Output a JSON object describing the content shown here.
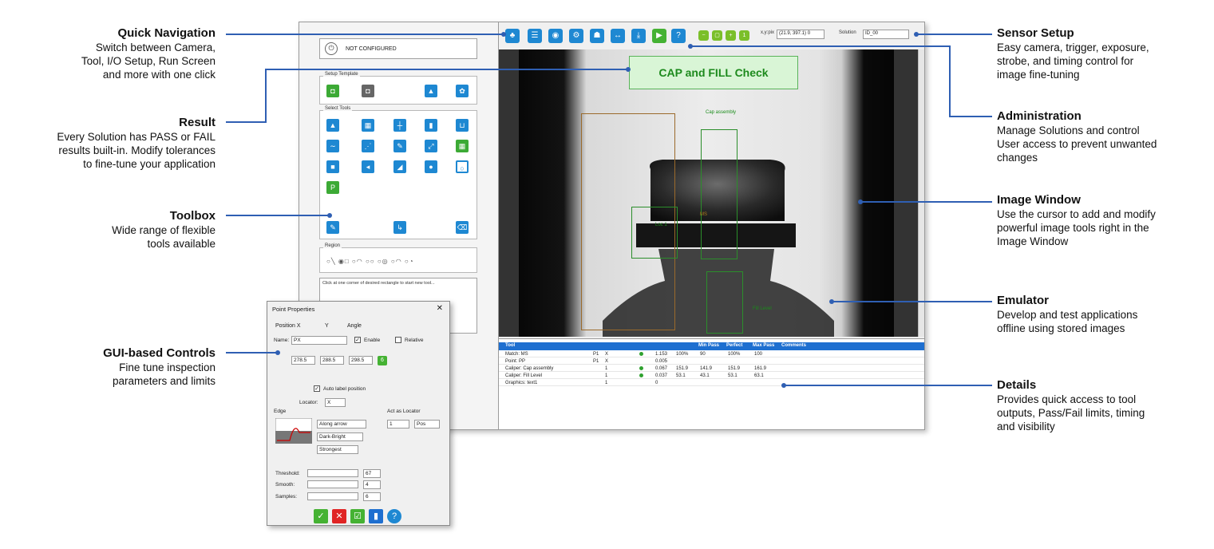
{
  "annotations": {
    "quick_navigation": {
      "title": "Quick Navigation",
      "lines": [
        "Switch between Camera,",
        "Tool, I/O Setup, Run Screen",
        "and more with one click"
      ]
    },
    "result": {
      "title": "Result",
      "lines": [
        "Every Solution has PASS or FAIL",
        "results built-in.  Modify tolerances",
        "to fine-tune your application"
      ]
    },
    "toolbox": {
      "title": "Toolbox",
      "lines": [
        "Wide range of flexible",
        "tools available"
      ]
    },
    "gui_controls": {
      "title": "GUI-based Controls",
      "lines": [
        "Fine tune inspection",
        "parameters and limits"
      ]
    },
    "sensor_setup": {
      "title": "Sensor Setup",
      "lines": [
        "Easy camera, trigger, exposure,",
        "strobe, and timing control for",
        "image fine-tuning"
      ]
    },
    "administration": {
      "title": "Administration",
      "lines": [
        "Manage Solutions and control",
        "User access to prevent unwanted",
        "changes"
      ]
    },
    "image_window": {
      "title": "Image Window",
      "lines": [
        "Use the cursor to add and modify",
        "powerful image tools right in the",
        "Image Window"
      ]
    },
    "emulator": {
      "title": "Emulator",
      "lines": [
        "Develop and test applications",
        "offline using stored images"
      ]
    },
    "details": {
      "title": "Details",
      "lines": [
        "Provides quick access to tool",
        "outputs, Pass/Fail limits, timing",
        "and visibility"
      ]
    }
  },
  "app": {
    "status": "NOT CONFIGURED",
    "setup_template_label": "Setup Template",
    "select_tools_label": "Select Tools",
    "region_label": "Region",
    "hint": "Click at one corner of desired rectangle to start new tool...",
    "xy_label": "x,y:pix",
    "xy_value": "(21.9, 397.1) 0",
    "solution_label": "Solution",
    "solution_value": "ID_00",
    "result_banner": "CAP and FILL Check",
    "image_labels": {
      "cap": "Cap assembly",
      "ms": "MS",
      "loc": "Loc 1",
      "fill": "Fill Level"
    }
  },
  "details_table": {
    "headers": [
      "Tool",
      "Min Pass",
      "Perfect",
      "Max Pass",
      "Comments"
    ],
    "rows": [
      {
        "tool": "Match: MS",
        "c1": "P1",
        "c2": "X",
        "val": "1.153",
        "v2": "100%",
        "min": "90",
        "perfect": "100%",
        "max": "100"
      },
      {
        "tool": "Point: PP",
        "c1": "P1",
        "c2": "X",
        "val": "0.005",
        "v2": "",
        "min": "",
        "perfect": "",
        "max": ""
      },
      {
        "tool": "Caliper: Cap assembly",
        "c1": "",
        "c2": "1",
        "val": "0.067",
        "v2": "151.9",
        "min": "141.9",
        "perfect": "151.9",
        "max": "161.9"
      },
      {
        "tool": "Caliper: Fill Level",
        "c1": "",
        "c2": "1",
        "val": "0.037",
        "v2": "53.1",
        "min": "43.1",
        "perfect": "53.1",
        "max": "63.1"
      },
      {
        "tool": "Graphics: text1",
        "c1": "",
        "c2": "1",
        "val": "0",
        "v2": "",
        "min": "",
        "perfect": "",
        "max": ""
      }
    ]
  },
  "dialog": {
    "title": "Point Properties",
    "tabs": [
      "Position  X",
      "Y",
      "Angle"
    ],
    "name_label": "Name:",
    "name_value": "PX",
    "enable_label": "Enable",
    "relative_label": "Relative",
    "pos_values": [
      "278.5",
      "288.5",
      "298.5"
    ],
    "auto_label": "Auto label position",
    "locator_label": "Locator:",
    "locator_value": "X",
    "edge_label": "Edge",
    "act_as_locator_label": "Act as Locator",
    "act_value": "1",
    "pos_value": "Pos",
    "along_arrow": "Along arrow",
    "dark_bright": "Dark-Bright",
    "strongest": "Strongest",
    "threshold_label": "Threshold:",
    "threshold_value": "67",
    "smooth_label": "Smooth:",
    "smooth_value": "4",
    "samples_label": "Samples:",
    "samples_value": "6"
  }
}
